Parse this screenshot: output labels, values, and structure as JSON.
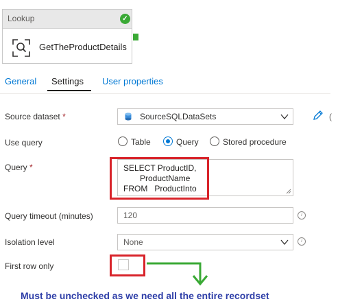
{
  "activity": {
    "type_label": "Lookup",
    "name": "GetTheProductDetails",
    "status_icon": "checkmark-circle-icon",
    "activity_icon": "lookup-search-icon",
    "colors": {
      "success": "#3aa935"
    }
  },
  "tabs": [
    {
      "label": "General"
    },
    {
      "label": "Settings"
    },
    {
      "label": "User properties"
    }
  ],
  "form": {
    "source_dataset": {
      "label": "Source dataset",
      "required_mark": "*",
      "value": "SourceSQLDataSets",
      "icon": "sql-database-icon"
    },
    "use_query": {
      "label": "Use query",
      "options": [
        "Table",
        "Query",
        "Stored procedure"
      ],
      "selected": "Query"
    },
    "query": {
      "label": "Query",
      "required_mark": "*",
      "lines": [
        "SELECT ProductID,",
        "ProductName",
        "FROM   ProductInto"
      ]
    },
    "timeout": {
      "label": "Query timeout (minutes)",
      "value": "120"
    },
    "isolation": {
      "label": "Isolation level",
      "value": "None"
    },
    "first_row_only": {
      "label": "First row only",
      "checked": false
    }
  },
  "annotation": {
    "note": "Must be unchecked as we need all the entire recordset",
    "highlight_color": "#d8232a",
    "arrow_color": "#3aa935",
    "note_color": "#2f3fa8"
  }
}
